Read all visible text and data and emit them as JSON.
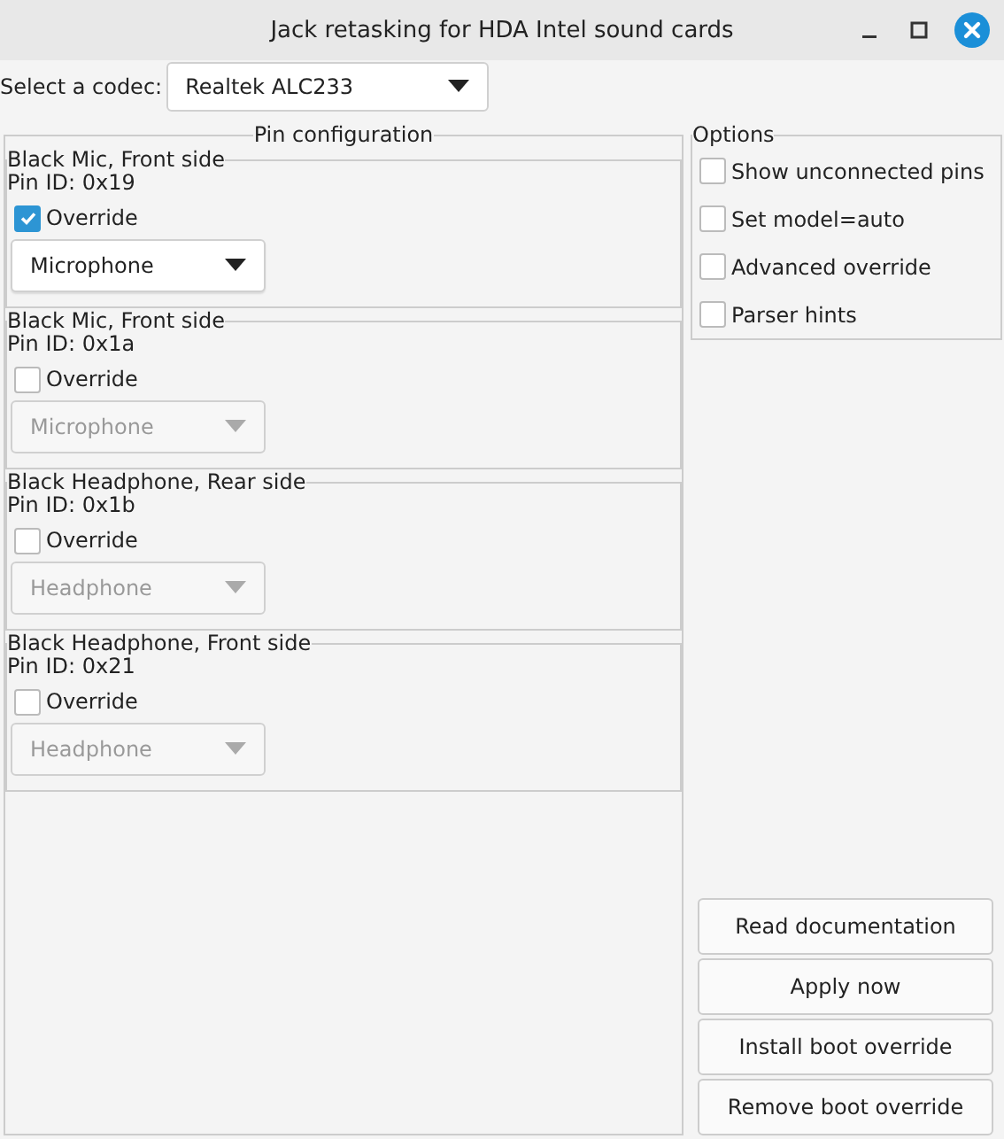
{
  "window": {
    "title": "Jack retasking for HDA Intel sound cards"
  },
  "codec": {
    "label": "Select a codec:",
    "value": "Realtek ALC233"
  },
  "pin_configuration": {
    "title": "Pin configuration",
    "pins": [
      {
        "name": "Black Mic, Front side",
        "pin_id": "Pin ID: 0x19",
        "override_label": "Override",
        "checked": true,
        "value": "Microphone",
        "disabled": false
      },
      {
        "name": "Black Mic, Front side",
        "pin_id": "Pin ID: 0x1a",
        "override_label": "Override",
        "checked": false,
        "value": "Microphone",
        "disabled": true
      },
      {
        "name": "Black Headphone, Rear side",
        "pin_id": "Pin ID: 0x1b",
        "override_label": "Override",
        "checked": false,
        "value": "Headphone",
        "disabled": true
      },
      {
        "name": "Black Headphone, Front side",
        "pin_id": "Pin ID: 0x21",
        "override_label": "Override",
        "checked": false,
        "value": "Headphone",
        "disabled": true
      }
    ]
  },
  "options": {
    "title": "Options",
    "items": [
      {
        "label": "Show unconnected pins",
        "checked": false
      },
      {
        "label": "Set model=auto",
        "checked": false
      },
      {
        "label": "Advanced override",
        "checked": false
      },
      {
        "label": "Parser hints",
        "checked": false
      }
    ]
  },
  "buttons": [
    "Read documentation",
    "Apply now",
    "Install boot override",
    "Remove boot override"
  ]
}
